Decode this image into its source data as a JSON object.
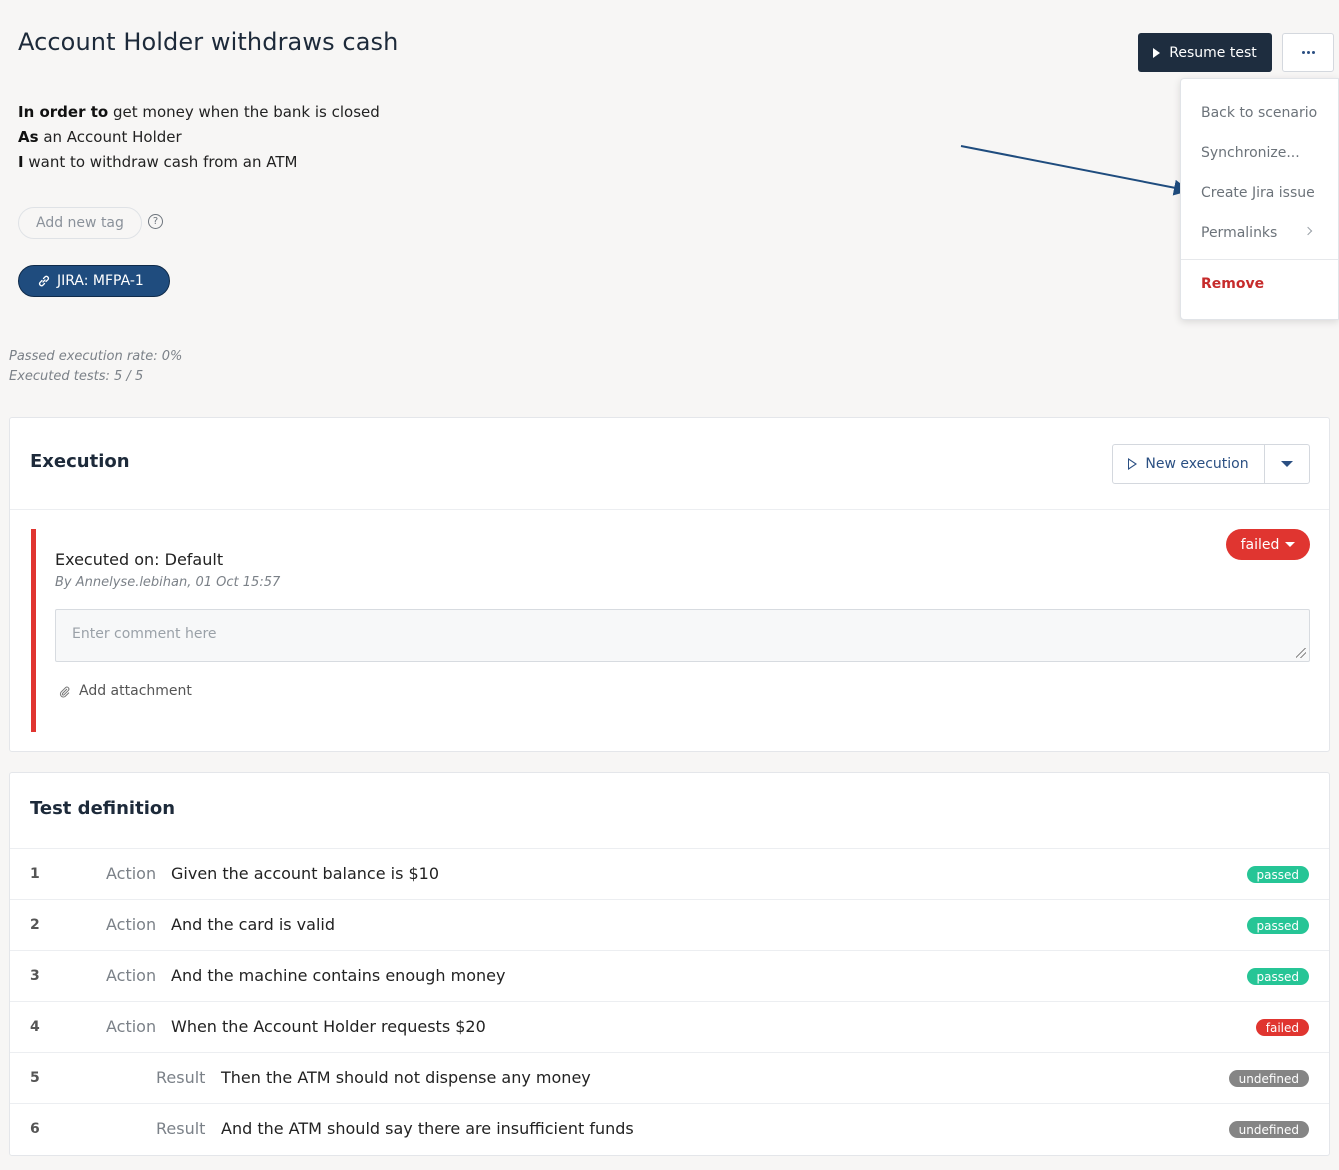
{
  "header": {
    "title": "Account Holder withdraws cash",
    "resume_label": "Resume test"
  },
  "story": {
    "lines": [
      {
        "kw": "In order to",
        "text": " get money when the bank is closed"
      },
      {
        "kw": "As",
        "text": " an Account Holder"
      },
      {
        "kw": "I",
        "text": " want to withdraw cash from an ATM"
      }
    ]
  },
  "tags": {
    "placeholder": "Add new tag",
    "help": "?",
    "jira_link": "JIRA: MFPA-1"
  },
  "stats": {
    "passed_rate": "Passed execution rate: 0%",
    "executed": "Executed tests: 5 / 5"
  },
  "menu": {
    "items": [
      "Back to scenario",
      "Synchronize...",
      "Create Jira issue",
      "Permalinks"
    ],
    "remove": "Remove"
  },
  "execution": {
    "title": "Execution",
    "new_execution": "New execution",
    "executed_on": "Executed on: Default",
    "by": "By Annelyse.lebihan, 01 Oct 15:57",
    "status": "failed",
    "comment_placeholder": "Enter comment here",
    "add_attachment": "Add attachment"
  },
  "definition": {
    "title": "Test definition",
    "steps": [
      {
        "num": "1",
        "kw": "Action",
        "text": "Given the account balance is $10",
        "status": "passed"
      },
      {
        "num": "2",
        "kw": "Action",
        "text": "And the card is valid",
        "status": "passed"
      },
      {
        "num": "3",
        "kw": "Action",
        "text": "And the machine contains enough money",
        "status": "passed"
      },
      {
        "num": "4",
        "kw": "Action",
        "text": "When the Account Holder requests $20",
        "status": "failed"
      },
      {
        "num": "5",
        "kw": "Result",
        "text": "Then the ATM should not dispense any money",
        "status": "undefined"
      },
      {
        "num": "6",
        "kw": "Result",
        "text": "And the ATM should say there are insufficient funds",
        "status": "undefined"
      }
    ]
  },
  "colors": {
    "primary_dark": "#1e2d3f",
    "link_blue": "#2a4f82",
    "failed_red": "#e03530",
    "passed_green": "#26c596",
    "undefined_grey": "#858585"
  }
}
